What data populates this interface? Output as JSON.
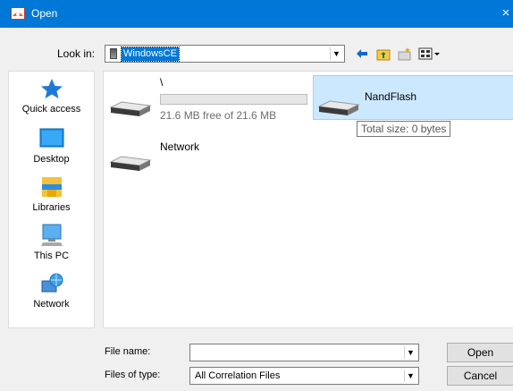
{
  "window": {
    "title": "Open",
    "close_glyph": "×",
    "accent": "#0078d7"
  },
  "toolbar": {
    "lookin_label": "Look in:",
    "lookin_value": "WindowsCE",
    "back_icon": "back-arrow-icon",
    "up_icon": "up-folder-icon",
    "newfolder_icon": "new-folder-icon",
    "views_icon": "view-menu-icon"
  },
  "places": [
    {
      "label": "Quick access",
      "icon": "quick-access-icon"
    },
    {
      "label": "Desktop",
      "icon": "desktop-icon"
    },
    {
      "label": "Libraries",
      "icon": "libraries-icon"
    },
    {
      "label": "This PC",
      "icon": "this-pc-icon"
    },
    {
      "label": "Network",
      "icon": "network-icon"
    }
  ],
  "items": [
    {
      "name": "\\",
      "free": "21.6 MB free of 21.6 MB",
      "used_fraction": 0.0
    },
    {
      "name": "NandFlash",
      "tooltip": "Total size: 0 bytes"
    },
    {
      "name": "Network"
    }
  ],
  "footer": {
    "filename_label": "File name:",
    "filename_value": "",
    "filetype_label": "Files of type:",
    "filetype_value": "All Correlation Files",
    "open_label": "Open",
    "cancel_label": "Cancel"
  }
}
